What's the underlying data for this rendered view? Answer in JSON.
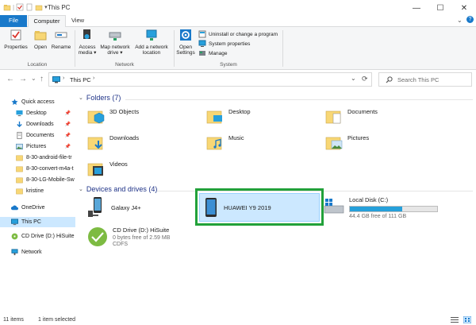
{
  "window": {
    "title": "This PC",
    "minimize": "—",
    "maximize": "☐",
    "close": "✕"
  },
  "tabs": {
    "file": "File",
    "computer": "Computer",
    "view": "View"
  },
  "ribbon": {
    "location": {
      "properties": "Properties",
      "open": "Open",
      "rename": "Rename",
      "label": "Location"
    },
    "network": {
      "access_media_1": "Access",
      "access_media_2": "media ▾",
      "map_drive_1": "Map network",
      "map_drive_2": "drive ▾",
      "add_location_1": "Add a network",
      "add_location_2": "location",
      "label": "Network"
    },
    "system": {
      "open_settings_1": "Open",
      "open_settings_2": "Settings",
      "uninstall": "Uninstall or change a program",
      "system_properties": "System properties",
      "manage": "Manage",
      "label": "System"
    }
  },
  "nav": {
    "back": "←",
    "forward": "→",
    "recent": "⌄",
    "up": "↑",
    "address": "This PC",
    "address_sep": "›",
    "address_arrow": "⌄",
    "refresh": "⟳",
    "search_placeholder": "Search This PC"
  },
  "sidebar": {
    "quick_access": "Quick access",
    "items": [
      "Desktop",
      "Downloads",
      "Documents",
      "Pictures",
      "8-30-android-file-tr",
      "8-30-convert-m4a-t",
      "8-30-LG-Mobile-Sw",
      "kristine"
    ],
    "onedrive": "OneDrive",
    "this_pc": "This PC",
    "cd_drive": "CD Drive (D:) HiSuite",
    "network": "Network"
  },
  "folders": {
    "header": "Folders (7)",
    "items": [
      "3D Objects",
      "Desktop",
      "Documents",
      "Downloads",
      "Music",
      "Pictures",
      "Videos"
    ]
  },
  "devices": {
    "header": "Devices and drives (4)",
    "galaxy": "Galaxy J4+",
    "huawei": "HUAWEI Y9 2019",
    "local_disk": "Local Disk (C:)",
    "local_disk_free": "44.4 GB free of 111 GB",
    "local_disk_used_fraction": 0.6,
    "cd": "CD Drive (D:) HiSuite",
    "cd_free": "0 bytes free of 2.59 MB",
    "cd_fs": "CDFS"
  },
  "status": {
    "items": "11 items",
    "selected": "1 item selected"
  },
  "colors": {
    "accent": "#1979ca",
    "selection": "#cce8ff",
    "highlight_box": "#22a13a",
    "folder": "#f8d775"
  }
}
